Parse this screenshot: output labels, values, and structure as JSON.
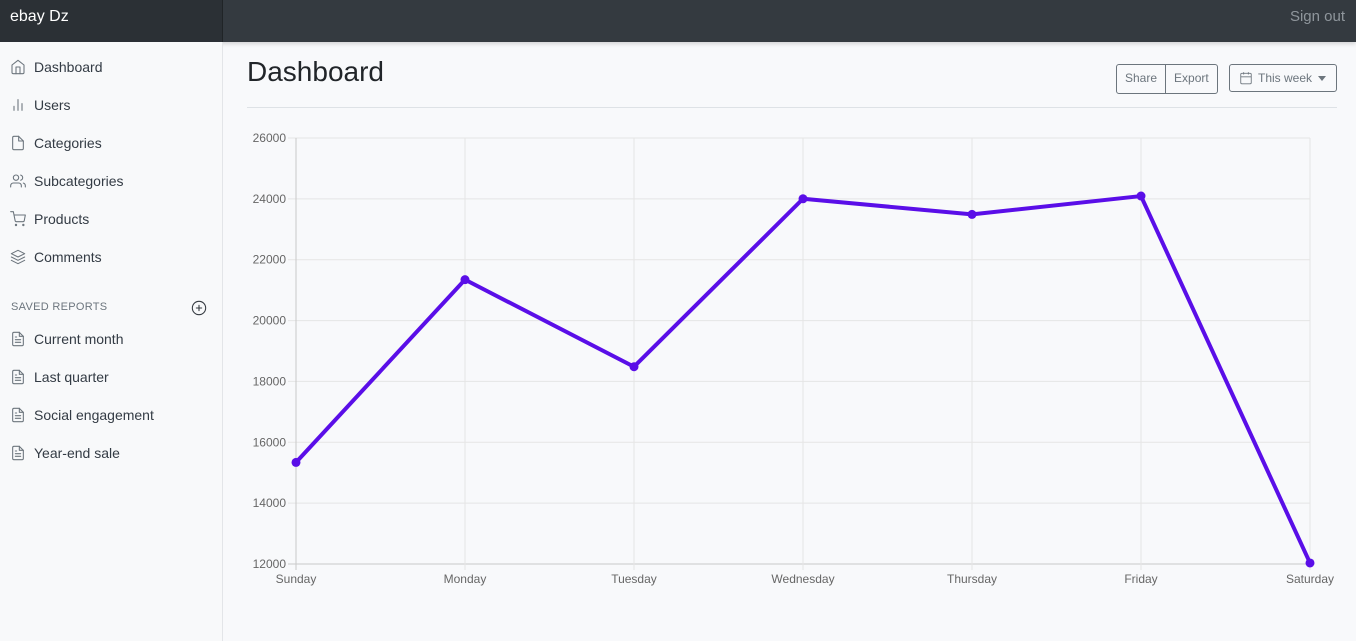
{
  "navbar": {
    "brand": "ebay Dz",
    "signout_label": "Sign out"
  },
  "sidebar": {
    "items": [
      {
        "label": "Dashboard",
        "icon": "home-icon"
      },
      {
        "label": "Users",
        "icon": "bar-chart-icon"
      },
      {
        "label": "Categories",
        "icon": "file-icon"
      },
      {
        "label": "Subcategories",
        "icon": "users-icon"
      },
      {
        "label": "Products",
        "icon": "shopping-cart-icon"
      },
      {
        "label": "Comments",
        "icon": "layers-icon"
      }
    ],
    "saved_reports_heading": "SAVED REPORTS",
    "saved_reports": [
      {
        "label": "Current month",
        "icon": "file-text-icon"
      },
      {
        "label": "Last quarter",
        "icon": "file-text-icon"
      },
      {
        "label": "Social engagement",
        "icon": "file-text-icon"
      },
      {
        "label": "Year-end sale",
        "icon": "file-text-icon"
      }
    ]
  },
  "main": {
    "title": "Dashboard",
    "toolbar": {
      "share_label": "Share",
      "export_label": "Export",
      "range_label": "This week"
    }
  },
  "colors": {
    "navbar": "#343a40",
    "line": "#5a0ee8",
    "background": "#f8f9fb"
  },
  "chart_data": {
    "type": "line",
    "categories": [
      "Sunday",
      "Monday",
      "Tuesday",
      "Wednesday",
      "Thursday",
      "Friday",
      "Saturday"
    ],
    "series": [
      {
        "values": [
          15339,
          21345,
          18483,
          24003,
          23489,
          24092,
          12034
        ]
      }
    ],
    "ylim": [
      12000,
      26000
    ],
    "yticks": [
      12000,
      14000,
      16000,
      18000,
      20000,
      22000,
      24000,
      26000
    ],
    "grid": true,
    "legend": "none"
  }
}
